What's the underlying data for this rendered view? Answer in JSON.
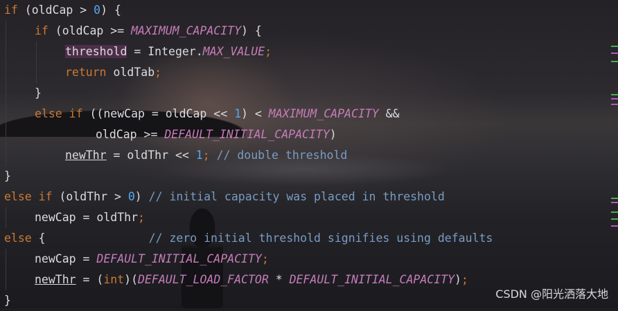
{
  "editor": {
    "lines": [
      {
        "indent": 0,
        "tokens": [
          {
            "t": "if",
            "c": "kw"
          },
          {
            "t": " (oldCap > ",
            "c": "plain"
          },
          {
            "t": "0",
            "c": "num"
          },
          {
            "t": ") {",
            "c": "plain"
          }
        ]
      },
      {
        "indent": 1,
        "tokens": [
          {
            "t": "if",
            "c": "kw"
          },
          {
            "t": " (oldCap >= ",
            "c": "plain"
          },
          {
            "t": "MAXIMUM_CAPACITY",
            "c": "const"
          },
          {
            "t": ") {",
            "c": "plain"
          }
        ]
      },
      {
        "indent": 2,
        "tokens": [
          {
            "t": "threshold",
            "c": "plain hl"
          },
          {
            "t": " = Integer.",
            "c": "plain"
          },
          {
            "t": "MAX_VALUE",
            "c": "const"
          },
          {
            "t": ";",
            "c": "semi"
          }
        ]
      },
      {
        "indent": 2,
        "tokens": [
          {
            "t": "return",
            "c": "kw"
          },
          {
            "t": " oldTab",
            "c": "plain"
          },
          {
            "t": ";",
            "c": "semi"
          }
        ]
      },
      {
        "indent": 1,
        "tokens": [
          {
            "t": "}",
            "c": "plain"
          }
        ]
      },
      {
        "indent": 1,
        "tokens": [
          {
            "t": "else if",
            "c": "kw"
          },
          {
            "t": " ((newCap = oldCap << ",
            "c": "plain"
          },
          {
            "t": "1",
            "c": "num"
          },
          {
            "t": ") < ",
            "c": "plain"
          },
          {
            "t": "MAXIMUM_CAPACITY",
            "c": "const"
          },
          {
            "t": " &&",
            "c": "plain"
          }
        ]
      },
      {
        "indent": 3,
        "tokens": [
          {
            "t": "oldCap >= ",
            "c": "plain"
          },
          {
            "t": "DEFAULT_INITIAL_CAPACITY",
            "c": "const"
          },
          {
            "t": ")",
            "c": "plain"
          }
        ]
      },
      {
        "indent": 2,
        "tokens": [
          {
            "t": "newThr",
            "c": "plain ul"
          },
          {
            "t": " = oldThr << ",
            "c": "plain"
          },
          {
            "t": "1",
            "c": "num"
          },
          {
            "t": "; ",
            "c": "semi"
          },
          {
            "t": "// double threshold",
            "c": "cmt"
          }
        ]
      },
      {
        "indent": 0,
        "tokens": [
          {
            "t": "}",
            "c": "plain"
          }
        ]
      },
      {
        "indent": 0,
        "tokens": [
          {
            "t": "else if",
            "c": "kw"
          },
          {
            "t": " (oldThr > ",
            "c": "plain"
          },
          {
            "t": "0",
            "c": "num"
          },
          {
            "t": ") ",
            "c": "plain"
          },
          {
            "t": "// initial capacity was placed in threshold",
            "c": "cmt"
          }
        ]
      },
      {
        "indent": 1,
        "tokens": [
          {
            "t": "newCap = oldThr",
            "c": "plain"
          },
          {
            "t": ";",
            "c": "semi"
          }
        ]
      },
      {
        "indent": 0,
        "tokens": [
          {
            "t": "else",
            "c": "kw"
          },
          {
            "t": " {               ",
            "c": "plain"
          },
          {
            "t": "// zero initial threshold signifies using defaults",
            "c": "cmt"
          }
        ]
      },
      {
        "indent": 1,
        "tokens": [
          {
            "t": "newCap = ",
            "c": "plain"
          },
          {
            "t": "DEFAULT_INITIAL_CAPACITY",
            "c": "const"
          },
          {
            "t": ";",
            "c": "semi"
          }
        ]
      },
      {
        "indent": 1,
        "tokens": [
          {
            "t": "newThr",
            "c": "plain ul"
          },
          {
            "t": " = (",
            "c": "plain"
          },
          {
            "t": "int",
            "c": "kw"
          },
          {
            "t": ")(",
            "c": "plain"
          },
          {
            "t": "DEFAULT_LOAD_FACTOR",
            "c": "const"
          },
          {
            "t": " * ",
            "c": "plain"
          },
          {
            "t": "DEFAULT_INITIAL_CAPACITY",
            "c": "const"
          },
          {
            "t": ")",
            "c": "plain"
          },
          {
            "t": ";",
            "c": "semi"
          }
        ]
      },
      {
        "indent": 0,
        "tokens": [
          {
            "t": "}",
            "c": "plain"
          }
        ]
      }
    ]
  },
  "gutter_markers": [
    {
      "color": "#4caf50"
    },
    {
      "color": "#b05cc0"
    },
    {
      "color": "#4caf50"
    },
    {
      "color": "#4caf50"
    },
    {
      "color": "#b05cc0"
    },
    {
      "color": "#b05cc0"
    },
    {
      "color": "#4caf50"
    },
    {
      "color": "#b05cc0"
    },
    {
      "color": "#4caf50"
    },
    {
      "color": "#4caf50"
    },
    {
      "color": "#b05cc0"
    }
  ],
  "watermark": "CSDN @阳光洒落大地",
  "theme": {
    "keyword": "#cc7832",
    "number": "#56a8f5",
    "constant": "#c77dba",
    "comment": "#7a9cc4",
    "text": "#dcdce0"
  }
}
